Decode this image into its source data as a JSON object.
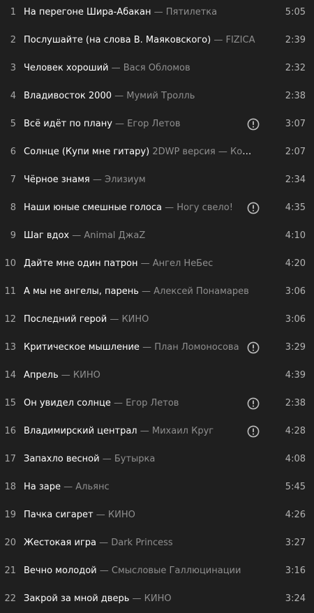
{
  "icons": {
    "warning": "explicit-warning-icon"
  },
  "tracks": [
    {
      "n": "1",
      "title": "На перегоне Шира-Абакан",
      "version": "",
      "artist": "Пятилетка",
      "dur": "5:05",
      "warn": false
    },
    {
      "n": "2",
      "title": "Послушайте (на слова В. Маяковского)",
      "version": "",
      "artist": "FIZICA",
      "dur": "2:39",
      "warn": false
    },
    {
      "n": "3",
      "title": "Человек хороший",
      "version": "",
      "artist": "Вася Обломов",
      "dur": "2:32",
      "warn": false
    },
    {
      "n": "4",
      "title": "Владивосток 2000",
      "version": "",
      "artist": "Мумий Тролль",
      "dur": "2:38",
      "warn": false
    },
    {
      "n": "5",
      "title": "Всё идёт по плану",
      "version": "",
      "artist": "Егор Летов",
      "dur": "3:07",
      "warn": true
    },
    {
      "n": "6",
      "title": "Солнце (Купи мне гитару)",
      "version": "2DWP версия",
      "artist": "Кошки ...",
      "dur": "2:07",
      "warn": false
    },
    {
      "n": "7",
      "title": "Чёрное знамя",
      "version": "",
      "artist": "Элизиум",
      "dur": "2:34",
      "warn": false
    },
    {
      "n": "8",
      "title": "Наши юные смешные голоса",
      "version": "",
      "artist": "Ногу свело!",
      "dur": "4:35",
      "warn": true
    },
    {
      "n": "9",
      "title": "Шаг вдох",
      "version": "",
      "artist": "Animal ДжаZ",
      "dur": "4:10",
      "warn": false
    },
    {
      "n": "10",
      "title": "Дайте мне один патрон",
      "version": "",
      "artist": "Ангел НеБес",
      "dur": "4:20",
      "warn": false
    },
    {
      "n": "11",
      "title": "А мы не ангелы, парень",
      "version": "",
      "artist": "Алексей Понамарев",
      "dur": "3:06",
      "warn": false
    },
    {
      "n": "12",
      "title": "Последний герой",
      "version": "",
      "artist": "КИНО",
      "dur": "3:06",
      "warn": false
    },
    {
      "n": "13",
      "title": "Критическое мышление",
      "version": "",
      "artist": "План Ломоносова",
      "dur": "3:29",
      "warn": true
    },
    {
      "n": "14",
      "title": "Апрель",
      "version": "",
      "artist": "КИНО",
      "dur": "4:39",
      "warn": false
    },
    {
      "n": "15",
      "title": "Он увидел солнце",
      "version": "",
      "artist": "Егор Летов",
      "dur": "2:38",
      "warn": true
    },
    {
      "n": "16",
      "title": "Владимирский централ",
      "version": "",
      "artist": "Михаил Круг",
      "dur": "4:28",
      "warn": true
    },
    {
      "n": "17",
      "title": "Запахло весной",
      "version": "",
      "artist": "Бутырка",
      "dur": "4:08",
      "warn": false
    },
    {
      "n": "18",
      "title": "На заре",
      "version": "",
      "artist": "Альянс",
      "dur": "5:45",
      "warn": false
    },
    {
      "n": "19",
      "title": "Пачка сигарет",
      "version": "",
      "artist": "КИНО",
      "dur": "4:26",
      "warn": false
    },
    {
      "n": "20",
      "title": "Жестокая игра",
      "version": "",
      "artist": "Dark Princess",
      "dur": "3:27",
      "warn": false
    },
    {
      "n": "21",
      "title": "Вечно молодой",
      "version": "",
      "artist": "Смысловые Галлюцинации",
      "dur": "3:16",
      "warn": false
    },
    {
      "n": "22",
      "title": "Закрой за мной дверь",
      "version": "",
      "artist": "КИНО",
      "dur": "3:24",
      "warn": false
    }
  ]
}
